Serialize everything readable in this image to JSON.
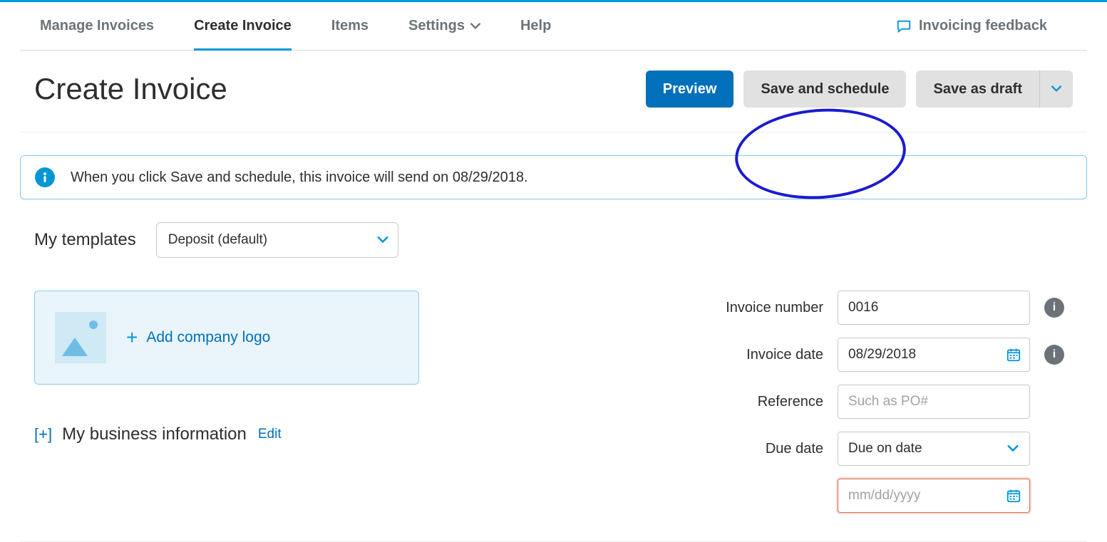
{
  "nav": {
    "items": [
      {
        "label": "Manage Invoices",
        "active": false,
        "hasDropdown": false
      },
      {
        "label": "Create Invoice",
        "active": true,
        "hasDropdown": false
      },
      {
        "label": "Items",
        "active": false,
        "hasDropdown": false
      },
      {
        "label": "Settings",
        "active": false,
        "hasDropdown": true
      },
      {
        "label": "Help",
        "active": false,
        "hasDropdown": false
      }
    ],
    "feedback_label": "Invoicing feedback"
  },
  "header": {
    "title": "Create Invoice",
    "preview_label": "Preview",
    "save_schedule_label": "Save and schedule",
    "save_draft_label": "Save as draft"
  },
  "info_banner": {
    "text": "When you click Save and schedule, this invoice will send on 08/29/2018."
  },
  "templates": {
    "label": "My templates",
    "selected": "Deposit (default)"
  },
  "logo_drop": {
    "label": "Add company logo"
  },
  "business_info": {
    "expand_glyph": "[+]",
    "label": "My business information",
    "edit_label": "Edit"
  },
  "fields": {
    "invoice_number": {
      "label": "Invoice number",
      "value": "0016"
    },
    "invoice_date": {
      "label": "Invoice date",
      "value": "08/29/2018"
    },
    "reference": {
      "label": "Reference",
      "value": "",
      "placeholder": "Such as PO#"
    },
    "due_date": {
      "label": "Due date",
      "selected": "Due on date",
      "date_value": "",
      "date_placeholder": "mm/dd/yyyy"
    }
  },
  "annotation": {
    "highlighted_button": "save-schedule-button"
  },
  "colors": {
    "primary": "#0070ba",
    "accent": "#0096d6",
    "annotation": "#1b1bcf",
    "error_border": "#e06a5a"
  }
}
